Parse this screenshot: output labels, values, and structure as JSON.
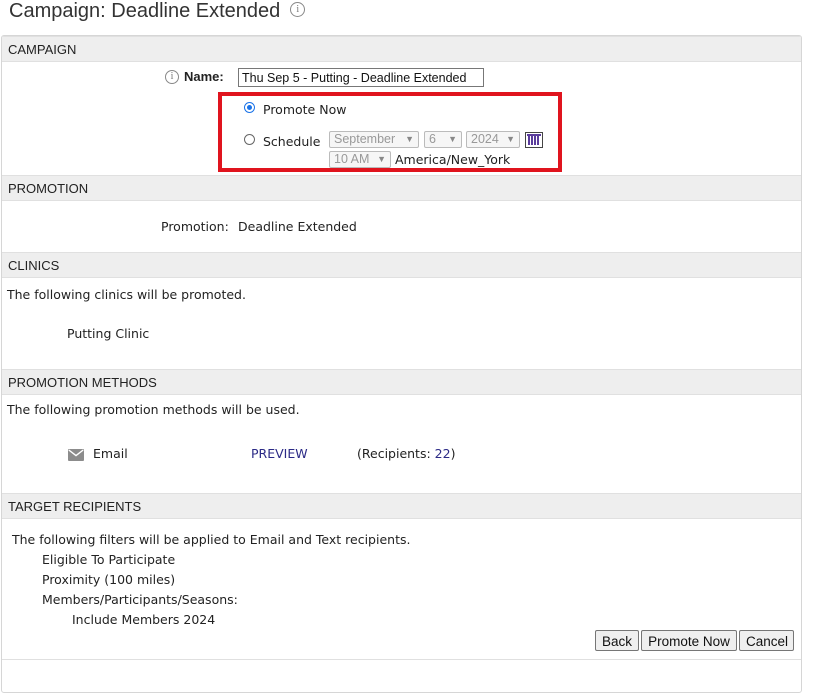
{
  "page": {
    "title": "Campaign: Deadline Extended",
    "title_info_icon": "info-icon"
  },
  "campaign": {
    "header": "CAMPAIGN",
    "name_label": "Name:",
    "name_value": "Thu Sep 5 - Putting - Deadline Extended",
    "promote_now_label": "Promote Now",
    "promote_now_selected": true,
    "schedule_label": "Schedule",
    "schedule_month": "September",
    "schedule_day": "6",
    "schedule_year": "2024",
    "schedule_time": "10 AM",
    "timezone": "America/New_York",
    "calendar_icon": "calendar-icon",
    "highlight_color": "#e0141e"
  },
  "promotion": {
    "header": "PROMOTION",
    "label": "Promotion:",
    "value": "Deadline Extended"
  },
  "clinics": {
    "header": "CLINICS",
    "intro": "The following clinics will be promoted.",
    "items": [
      "Putting Clinic"
    ]
  },
  "methods": {
    "header": "PROMOTION METHODS",
    "intro": "The following promotion methods will be used.",
    "items": [
      {
        "icon": "envelope-icon",
        "name": "Email",
        "preview_label": "PREVIEW",
        "recipients_prefix": "(Recipients: ",
        "recipients_count": "22",
        "recipients_suffix": ")"
      }
    ]
  },
  "recipients": {
    "header": "TARGET RECIPIENTS",
    "intro": "The following filters will be applied to Email and Text recipients.",
    "filters": [
      "Eligible To Participate",
      "Proximity (100 miles)",
      "Members/Participants/Seasons:"
    ],
    "sub_filters": [
      "Include Members 2024"
    ]
  },
  "actions": {
    "back": "Back",
    "promote_now": "Promote Now",
    "cancel": "Cancel"
  }
}
